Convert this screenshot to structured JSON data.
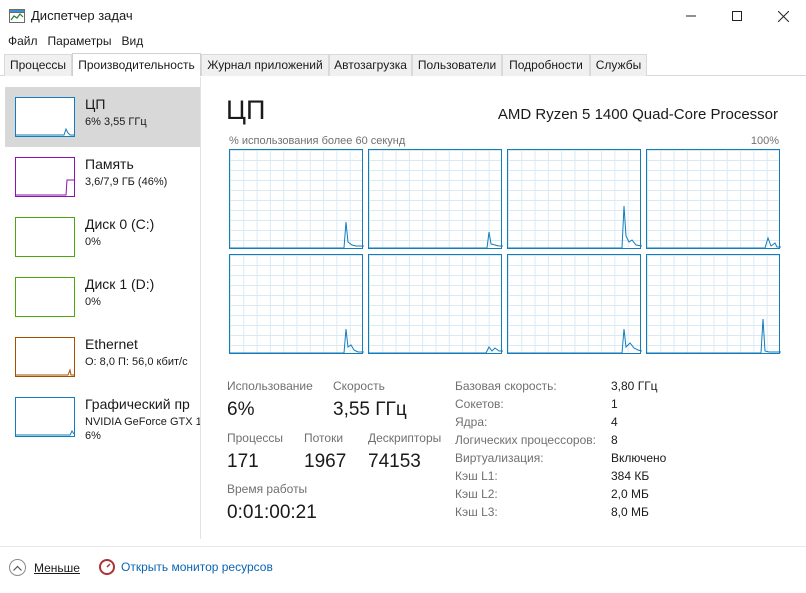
{
  "window": {
    "title": "Диспетчер задач"
  },
  "menu": [
    "Файл",
    "Параметры",
    "Вид"
  ],
  "tabs": [
    {
      "label": "Процессы",
      "active": false
    },
    {
      "label": "Производительность",
      "active": true
    },
    {
      "label": "Журнал приложений",
      "active": false
    },
    {
      "label": "Автозагрузка",
      "active": false
    },
    {
      "label": "Пользователи",
      "active": false
    },
    {
      "label": "Подробности",
      "active": false
    },
    {
      "label": "Службы",
      "active": false
    }
  ],
  "sidebar": {
    "items": [
      {
        "name": "ЦП",
        "sub": "6% 3,55 ГГц",
        "sub2": "",
        "color": "#117dbb",
        "selected": true
      },
      {
        "name": "Память",
        "sub": "3,6/7,9 ГБ (46%)",
        "sub2": "",
        "color": "#8b12ae",
        "selected": false
      },
      {
        "name": "Диск 0 (C:)",
        "sub": "0%",
        "sub2": "",
        "color": "#4da60c",
        "selected": false
      },
      {
        "name": "Диск 1 (D:)",
        "sub": "0%",
        "sub2": "",
        "color": "#4da60c",
        "selected": false
      },
      {
        "name": "Ethernet",
        "sub": "О: 8,0  П: 56,0 кбит/с",
        "sub2": "",
        "color": "#a74f01",
        "selected": false
      },
      {
        "name": "Графический пр",
        "sub": "NVIDIA GeForce GTX 1",
        "sub2": "6%",
        "color": "#117dbb",
        "selected": false
      }
    ]
  },
  "main": {
    "title": "ЦП",
    "model": "AMD Ryzen 5 1400 Quad-Core Processor",
    "graph_caption": "% использования более 60 секунд",
    "graph_max": "100%",
    "accent_color": "#117dbb",
    "stats": {
      "usage_label": "Использование",
      "usage_value": "6%",
      "speed_label": "Скорость",
      "speed_value": "3,55 ГГц",
      "processes_label": "Процессы",
      "processes_value": "171",
      "threads_label": "Потоки",
      "threads_value": "1967",
      "handles_label": "Дескрипторы",
      "handles_value": "74153",
      "uptime_label": "Время работы",
      "uptime_value": "0:01:00:21"
    },
    "specs": [
      {
        "label": "Базовая скорость:",
        "value": "3,80 ГГц"
      },
      {
        "label": "Сокетов:",
        "value": "1"
      },
      {
        "label": "Ядра:",
        "value": "4"
      },
      {
        "label": "Логических процессоров:",
        "value": "8"
      },
      {
        "label": "Виртуализация:",
        "value": "Включено"
      },
      {
        "label": "Кэш L1:",
        "value": "384 КБ"
      },
      {
        "label": "Кэш L2:",
        "value": "2,0 МБ"
      },
      {
        "label": "Кэш L3:",
        "value": "8,0 МБ"
      }
    ]
  },
  "footer": {
    "less_label": "Меньше",
    "monitor_label": "Открыть монитор ресурсов"
  }
}
